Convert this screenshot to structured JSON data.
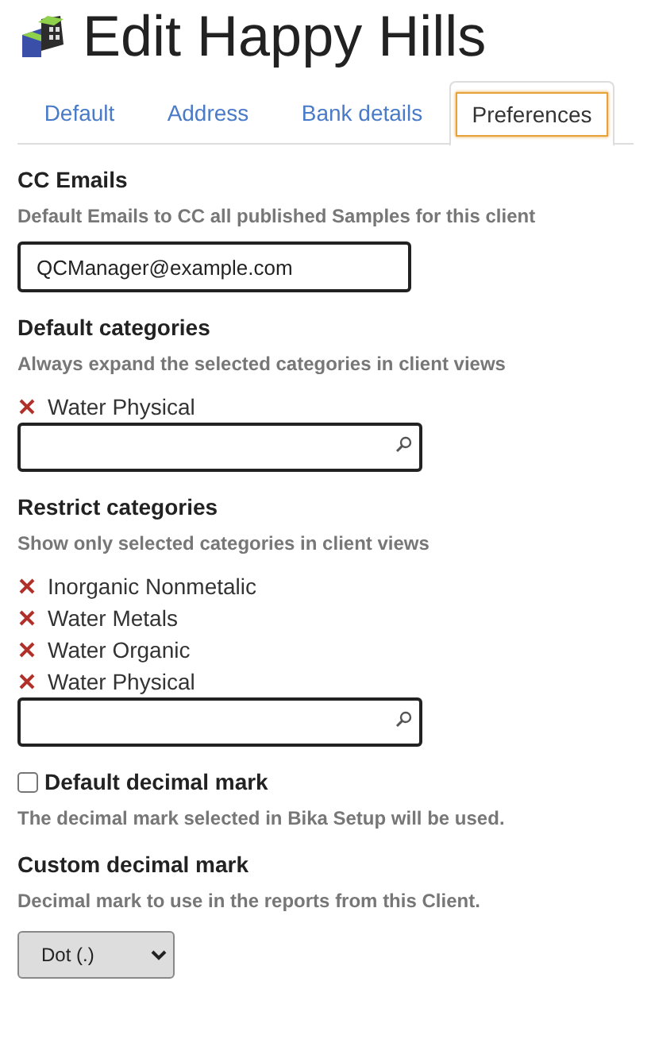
{
  "page_title": "Edit Happy Hills",
  "tabs": [
    {
      "label": "Default",
      "selected": false
    },
    {
      "label": "Address",
      "selected": false
    },
    {
      "label": "Bank details",
      "selected": false
    },
    {
      "label": "Preferences",
      "selected": true
    }
  ],
  "fields": [
    {
      "kind": "text",
      "label": "CC Emails",
      "help": "Default Emails to CC all published Samples for this client",
      "value": "QCManager@example.com"
    },
    {
      "kind": "multi",
      "label": "Default categories",
      "help": "Always expand the selected categories in client views",
      "items": [
        "Water Physical"
      ]
    },
    {
      "kind": "multi",
      "label": "Restrict categories",
      "help": "Show only selected categories in client views",
      "items": [
        "Inorganic Nonmetalic",
        "Water Metals",
        "Water Organic",
        "Water Physical"
      ]
    },
    {
      "kind": "checkbox",
      "label": "Default decimal mark",
      "help": "The decimal mark selected in Bika Setup will be used.",
      "checked": false
    },
    {
      "kind": "select",
      "label": "Custom decimal mark",
      "help": "Decimal mark to use in the reports from this Client.",
      "value": "Dot (.)"
    }
  ]
}
